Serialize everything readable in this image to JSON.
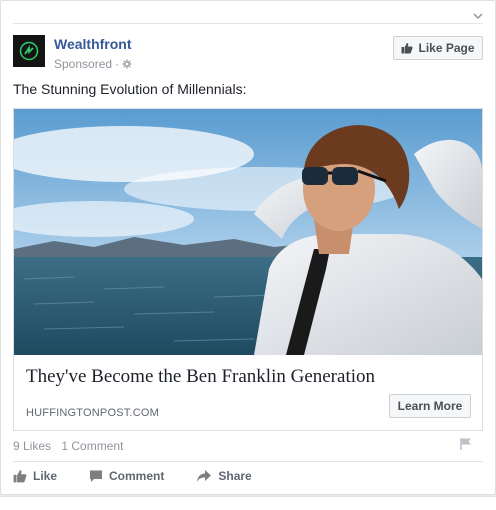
{
  "post": {
    "page_name": "Wealthfront",
    "sponsored_label": "Sponsored",
    "like_page_label": "Like Page",
    "text": "The Stunning Evolution of Millennials:"
  },
  "ad": {
    "headline": "They've Become the Ben Franklin Generation",
    "domain": "HUFFINGTONPOST.COM",
    "cta_label": "Learn More"
  },
  "stats": {
    "likes": "9 Likes",
    "comments": "1 Comment"
  },
  "actions": {
    "like": "Like",
    "comment": "Comment",
    "share": "Share"
  },
  "colors": {
    "link_blue": "#365899",
    "brand_green": "#2bd06b",
    "muted": "#90949c"
  },
  "icons": [
    "chevron-down-icon",
    "wealthfront-logo-icon",
    "gear-icon",
    "thumbs-up-icon",
    "flag-icon",
    "comment-icon",
    "share-arrow-icon"
  ]
}
